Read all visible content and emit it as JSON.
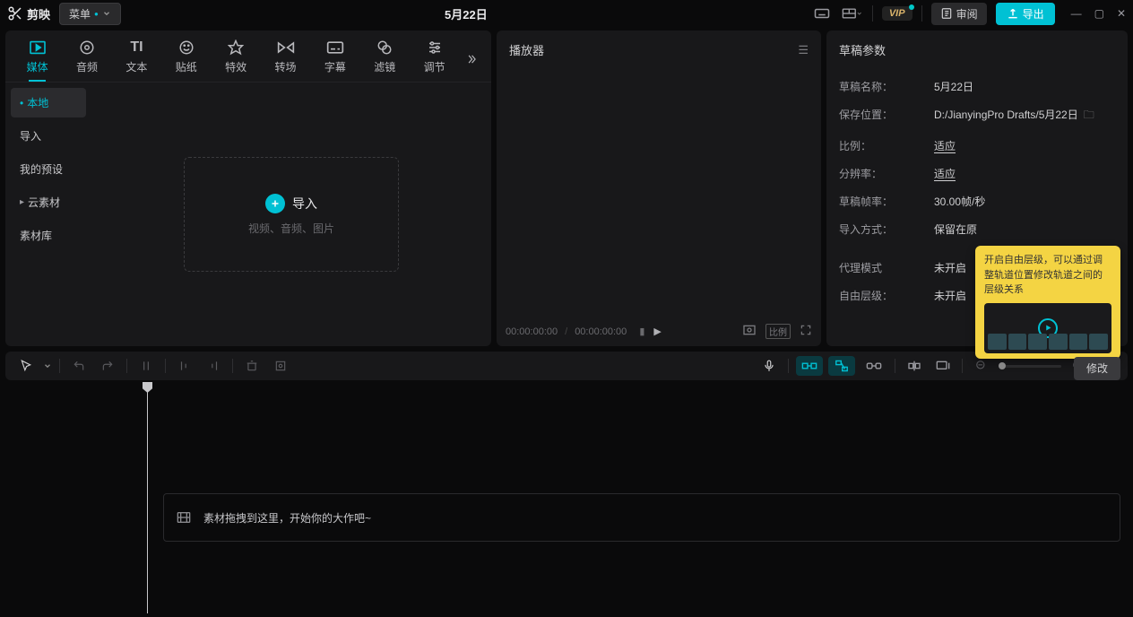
{
  "titlebar": {
    "app_name": "剪映",
    "menu_label": "菜单",
    "project_title": "5月22日",
    "vip_label": "VIP",
    "review_label": "审阅",
    "export_label": "导出"
  },
  "media_tabs": [
    {
      "label": "媒体",
      "icon": "media-icon"
    },
    {
      "label": "音频",
      "icon": "audio-icon"
    },
    {
      "label": "文本",
      "icon": "text-icon"
    },
    {
      "label": "贴纸",
      "icon": "sticker-icon"
    },
    {
      "label": "特效",
      "icon": "effects-icon"
    },
    {
      "label": "转场",
      "icon": "transition-icon"
    },
    {
      "label": "字幕",
      "icon": "subtitle-icon"
    },
    {
      "label": "滤镜",
      "icon": "filter-icon"
    },
    {
      "label": "调节",
      "icon": "adjust-icon"
    }
  ],
  "sidebar": {
    "items": [
      {
        "label": "本地"
      },
      {
        "label": "导入"
      },
      {
        "label": "我的预设"
      },
      {
        "label": "云素材"
      },
      {
        "label": "素材库"
      }
    ]
  },
  "import": {
    "button_label": "导入",
    "hint": "视频、音频、图片"
  },
  "player": {
    "title": "播放器",
    "time_current": "00:00:00:00",
    "time_total": "00:00:00:00",
    "ratio_label": "比例"
  },
  "props": {
    "title": "草稿参数",
    "rows": {
      "name_k": "草稿名称：",
      "name_v": "5月22日",
      "path_k": "保存位置：",
      "path_v": "D:/JianyingPro Drafts/5月22日",
      "ratio_k": "比例：",
      "ratio_v": "适应",
      "res_k": "分辨率：",
      "res_v": "适应",
      "fps_k": "草稿帧率：",
      "fps_v": "30.00帧/秒",
      "import_k": "导入方式：",
      "import_v": "保留在原",
      "proxy_k": "代理模式",
      "proxy_v": "未开启",
      "layer_k": "自由层级：",
      "layer_v": "未开启"
    },
    "tooltip_text": "开启自由层级，可以通过调整轨道位置修改轨道之间的层级关系",
    "modify_label": "修改"
  },
  "timeline": {
    "drop_hint": "素材拖拽到这里，开始你的大作吧~"
  }
}
